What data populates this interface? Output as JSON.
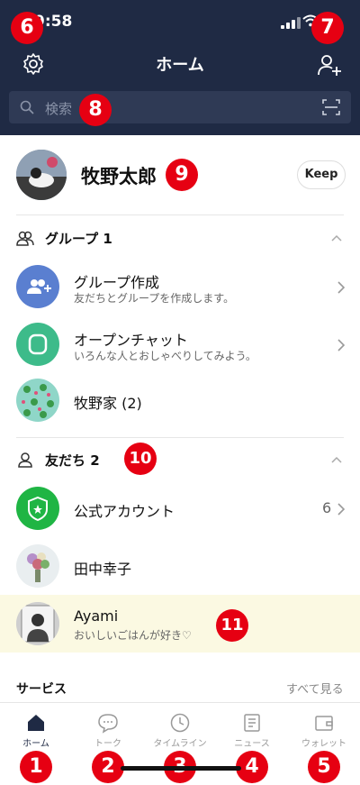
{
  "status": {
    "time": "9:58"
  },
  "header": {
    "title": "ホーム",
    "search_placeholder": "検索"
  },
  "annotations": [
    "1",
    "2",
    "3",
    "4",
    "5",
    "6",
    "7",
    "8",
    "9",
    "10",
    "11"
  ],
  "profile": {
    "name": "牧野太郎",
    "keep_label": "Keep"
  },
  "groups": {
    "header": "グループ 1",
    "items": [
      {
        "name": "グループ作成",
        "sub": "友だちとグループを作成します。"
      },
      {
        "name": "オープンチャット",
        "sub": "いろんな人とおしゃべりしてみよう。"
      },
      {
        "name": "牧野家 (2)"
      }
    ]
  },
  "friends": {
    "header": "友だち 2",
    "items": [
      {
        "name": "公式アカウント",
        "count": "6"
      },
      {
        "name": "田中幸子"
      },
      {
        "name": "Ayami",
        "sub": "おいしいごはんが好き♡"
      }
    ]
  },
  "services": {
    "label": "サービス",
    "see_all": "すべて見る"
  },
  "tabs": [
    {
      "label": "ホーム",
      "icon": "home-icon"
    },
    {
      "label": "トーク",
      "icon": "talk-icon"
    },
    {
      "label": "タイムライン",
      "icon": "clock-icon"
    },
    {
      "label": "ニュース",
      "icon": "news-icon"
    },
    {
      "label": "ウォレット",
      "icon": "wallet-icon"
    }
  ],
  "colors": {
    "header_bg": "#1f2a44",
    "badge": "#e60012",
    "highlight_row": "#fbf9e2",
    "line_green": "#1fb544"
  }
}
